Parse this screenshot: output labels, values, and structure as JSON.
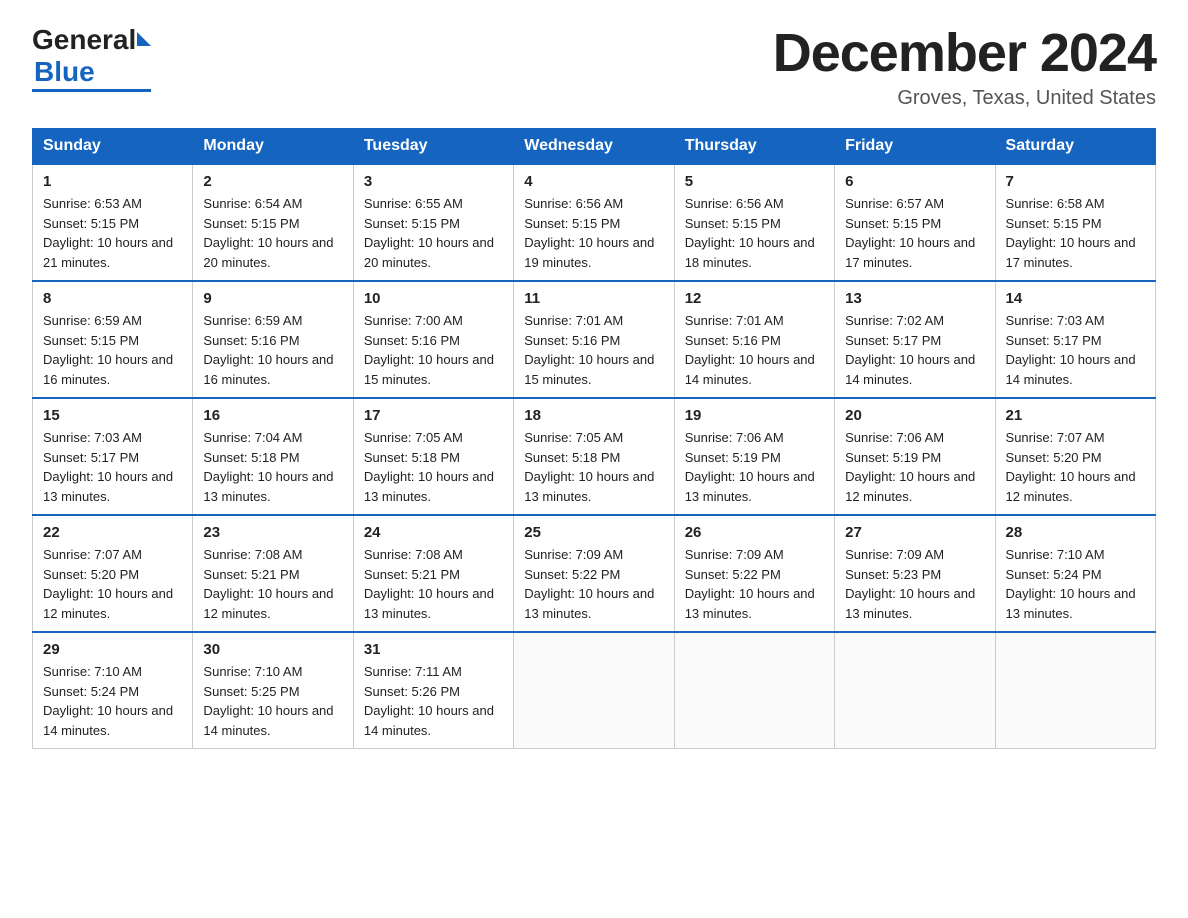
{
  "logo": {
    "general": "General",
    "arrow": "",
    "blue": "Blue"
  },
  "header": {
    "month": "December 2024",
    "location": "Groves, Texas, United States"
  },
  "weekdays": [
    "Sunday",
    "Monday",
    "Tuesday",
    "Wednesday",
    "Thursday",
    "Friday",
    "Saturday"
  ],
  "weeks": [
    [
      {
        "day": "1",
        "sunrise": "6:53 AM",
        "sunset": "5:15 PM",
        "daylight": "10 hours and 21 minutes."
      },
      {
        "day": "2",
        "sunrise": "6:54 AM",
        "sunset": "5:15 PM",
        "daylight": "10 hours and 20 minutes."
      },
      {
        "day": "3",
        "sunrise": "6:55 AM",
        "sunset": "5:15 PM",
        "daylight": "10 hours and 20 minutes."
      },
      {
        "day": "4",
        "sunrise": "6:56 AM",
        "sunset": "5:15 PM",
        "daylight": "10 hours and 19 minutes."
      },
      {
        "day": "5",
        "sunrise": "6:56 AM",
        "sunset": "5:15 PM",
        "daylight": "10 hours and 18 minutes."
      },
      {
        "day": "6",
        "sunrise": "6:57 AM",
        "sunset": "5:15 PM",
        "daylight": "10 hours and 17 minutes."
      },
      {
        "day": "7",
        "sunrise": "6:58 AM",
        "sunset": "5:15 PM",
        "daylight": "10 hours and 17 minutes."
      }
    ],
    [
      {
        "day": "8",
        "sunrise": "6:59 AM",
        "sunset": "5:15 PM",
        "daylight": "10 hours and 16 minutes."
      },
      {
        "day": "9",
        "sunrise": "6:59 AM",
        "sunset": "5:16 PM",
        "daylight": "10 hours and 16 minutes."
      },
      {
        "day": "10",
        "sunrise": "7:00 AM",
        "sunset": "5:16 PM",
        "daylight": "10 hours and 15 minutes."
      },
      {
        "day": "11",
        "sunrise": "7:01 AM",
        "sunset": "5:16 PM",
        "daylight": "10 hours and 15 minutes."
      },
      {
        "day": "12",
        "sunrise": "7:01 AM",
        "sunset": "5:16 PM",
        "daylight": "10 hours and 14 minutes."
      },
      {
        "day": "13",
        "sunrise": "7:02 AM",
        "sunset": "5:17 PM",
        "daylight": "10 hours and 14 minutes."
      },
      {
        "day": "14",
        "sunrise": "7:03 AM",
        "sunset": "5:17 PM",
        "daylight": "10 hours and 14 minutes."
      }
    ],
    [
      {
        "day": "15",
        "sunrise": "7:03 AM",
        "sunset": "5:17 PM",
        "daylight": "10 hours and 13 minutes."
      },
      {
        "day": "16",
        "sunrise": "7:04 AM",
        "sunset": "5:18 PM",
        "daylight": "10 hours and 13 minutes."
      },
      {
        "day": "17",
        "sunrise": "7:05 AM",
        "sunset": "5:18 PM",
        "daylight": "10 hours and 13 minutes."
      },
      {
        "day": "18",
        "sunrise": "7:05 AM",
        "sunset": "5:18 PM",
        "daylight": "10 hours and 13 minutes."
      },
      {
        "day": "19",
        "sunrise": "7:06 AM",
        "sunset": "5:19 PM",
        "daylight": "10 hours and 13 minutes."
      },
      {
        "day": "20",
        "sunrise": "7:06 AM",
        "sunset": "5:19 PM",
        "daylight": "10 hours and 12 minutes."
      },
      {
        "day": "21",
        "sunrise": "7:07 AM",
        "sunset": "5:20 PM",
        "daylight": "10 hours and 12 minutes."
      }
    ],
    [
      {
        "day": "22",
        "sunrise": "7:07 AM",
        "sunset": "5:20 PM",
        "daylight": "10 hours and 12 minutes."
      },
      {
        "day": "23",
        "sunrise": "7:08 AM",
        "sunset": "5:21 PM",
        "daylight": "10 hours and 12 minutes."
      },
      {
        "day": "24",
        "sunrise": "7:08 AM",
        "sunset": "5:21 PM",
        "daylight": "10 hours and 13 minutes."
      },
      {
        "day": "25",
        "sunrise": "7:09 AM",
        "sunset": "5:22 PM",
        "daylight": "10 hours and 13 minutes."
      },
      {
        "day": "26",
        "sunrise": "7:09 AM",
        "sunset": "5:22 PM",
        "daylight": "10 hours and 13 minutes."
      },
      {
        "day": "27",
        "sunrise": "7:09 AM",
        "sunset": "5:23 PM",
        "daylight": "10 hours and 13 minutes."
      },
      {
        "day": "28",
        "sunrise": "7:10 AM",
        "sunset": "5:24 PM",
        "daylight": "10 hours and 13 minutes."
      }
    ],
    [
      {
        "day": "29",
        "sunrise": "7:10 AM",
        "sunset": "5:24 PM",
        "daylight": "10 hours and 14 minutes."
      },
      {
        "day": "30",
        "sunrise": "7:10 AM",
        "sunset": "5:25 PM",
        "daylight": "10 hours and 14 minutes."
      },
      {
        "day": "31",
        "sunrise": "7:11 AM",
        "sunset": "5:26 PM",
        "daylight": "10 hours and 14 minutes."
      },
      null,
      null,
      null,
      null
    ]
  ]
}
